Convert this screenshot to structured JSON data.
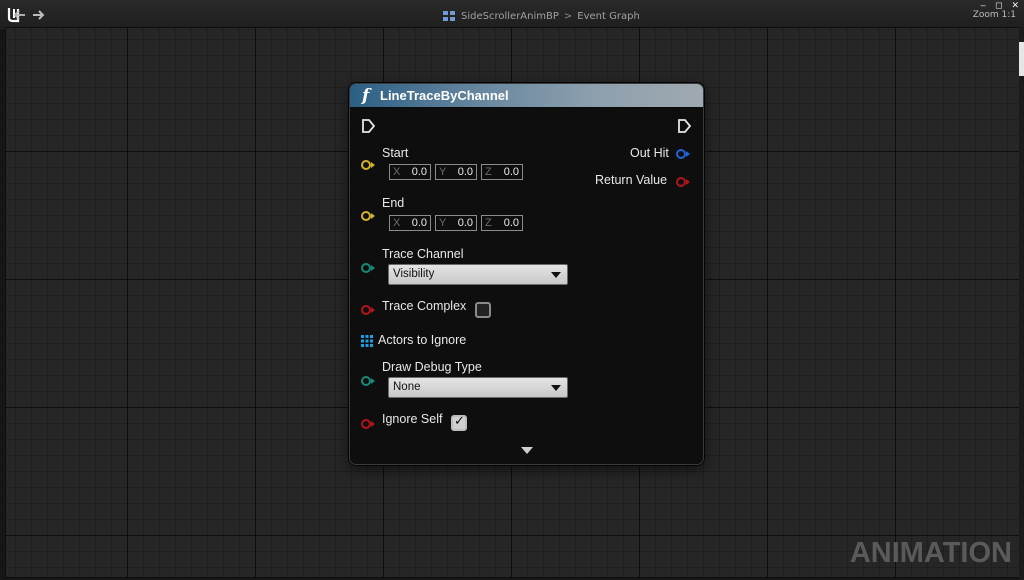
{
  "breadcrumb": {
    "blueprint": "SideScrollerAnimBP",
    "separator": ">",
    "graph": "Event Graph"
  },
  "zoom_label": "Zoom 1:1",
  "window_controls": {
    "minimize": "‒",
    "restore": "◻",
    "close": "✕"
  },
  "watermark": "ANIMATION",
  "node": {
    "title": "LineTraceByChannel",
    "func_icon": "f",
    "header_color": "#2c5f85",
    "pins": {
      "start": {
        "label": "Start",
        "x_axis": "X",
        "x": "0.0",
        "y_axis": "Y",
        "y": "0.0",
        "z_axis": "Z",
        "z": "0.0",
        "color": "#d7b22a"
      },
      "end": {
        "label": "End",
        "x_axis": "X",
        "x": "0.0",
        "y_axis": "Y",
        "y": "0.0",
        "z_axis": "Z",
        "z": "0.0",
        "color": "#d7b22a"
      },
      "trace_channel": {
        "label": "Trace Channel",
        "value": "Visibility",
        "color": "#1a8a78"
      },
      "trace_complex": {
        "label": "Trace Complex",
        "checked": false,
        "color": "#b3151b"
      },
      "actors_to_ignore": {
        "label": "Actors to Ignore",
        "color": "#1ea0e6"
      },
      "draw_debug_type": {
        "label": "Draw Debug Type",
        "value": "None",
        "color": "#1a8a78"
      },
      "ignore_self": {
        "label": "Ignore Self",
        "checked": true,
        "color": "#b3151b"
      },
      "out_hit": {
        "label": "Out Hit",
        "color": "#1e64d6"
      },
      "return_value": {
        "label": "Return Value",
        "color": "#b3151b"
      }
    }
  }
}
